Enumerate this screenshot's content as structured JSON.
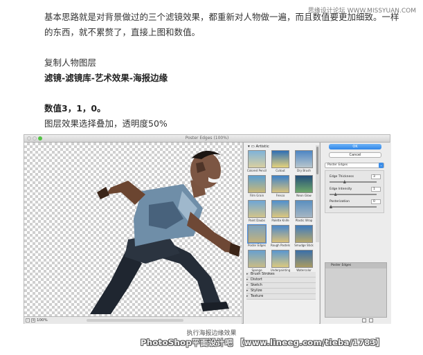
{
  "watermark_top": "思缘设计论坛 WWW.MISSYUAN.COM",
  "article": {
    "para1": "基本思路就是对背景做过的三个滤镜效果，都重新对人物做一遍，而且数值要更加细致。一样的东西，就不累赘了，直接上图和数值。",
    "step1": "复制人物图层",
    "step2": "滤镜-滤镜库-艺术效果-海报边缘",
    "values": "数值3，1，0。",
    "blend": "图层效果选择叠加，透明度50%"
  },
  "dialog": {
    "title": "Poster Edges (100%)",
    "zoom": "100%",
    "zoom_minus": "–",
    "zoom_plus": "+",
    "category_open": "Artistic",
    "thumbnails": [
      {
        "label": "Colored Pencil"
      },
      {
        "label": "Cutout"
      },
      {
        "label": "Dry Brush"
      },
      {
        "label": "Film Grain"
      },
      {
        "label": "Fresco"
      },
      {
        "label": "Neon Glow"
      },
      {
        "label": "Paint Daubs"
      },
      {
        "label": "Palette Knife"
      },
      {
        "label": "Plastic Wrap"
      },
      {
        "label": "Poster Edges"
      },
      {
        "label": "Rough Pastels"
      },
      {
        "label": "Smudge Stick"
      },
      {
        "label": "Sponge"
      },
      {
        "label": "Underpainting"
      },
      {
        "label": "Watercolor"
      }
    ],
    "categories": [
      "Brush Strokes",
      "Distort",
      "Sketch",
      "Stylize",
      "Texture"
    ],
    "ok_label": "OK",
    "cancel_label": "Cancel",
    "filter_select": "Poster Edges",
    "params": [
      {
        "label": "Edge Thickness",
        "value": "3",
        "fraction": 0.3
      },
      {
        "label": "Edge Intensity",
        "value": "1",
        "fraction": 0.1
      },
      {
        "label": "Posterization",
        "value": "0",
        "fraction": 0.0
      }
    ],
    "layer_item": "Poster Edges"
  },
  "caption": "执行海报边缘效果",
  "credit": "PhotoShop平面设计吧 【www.lineeg.com/tieba/1783】"
}
